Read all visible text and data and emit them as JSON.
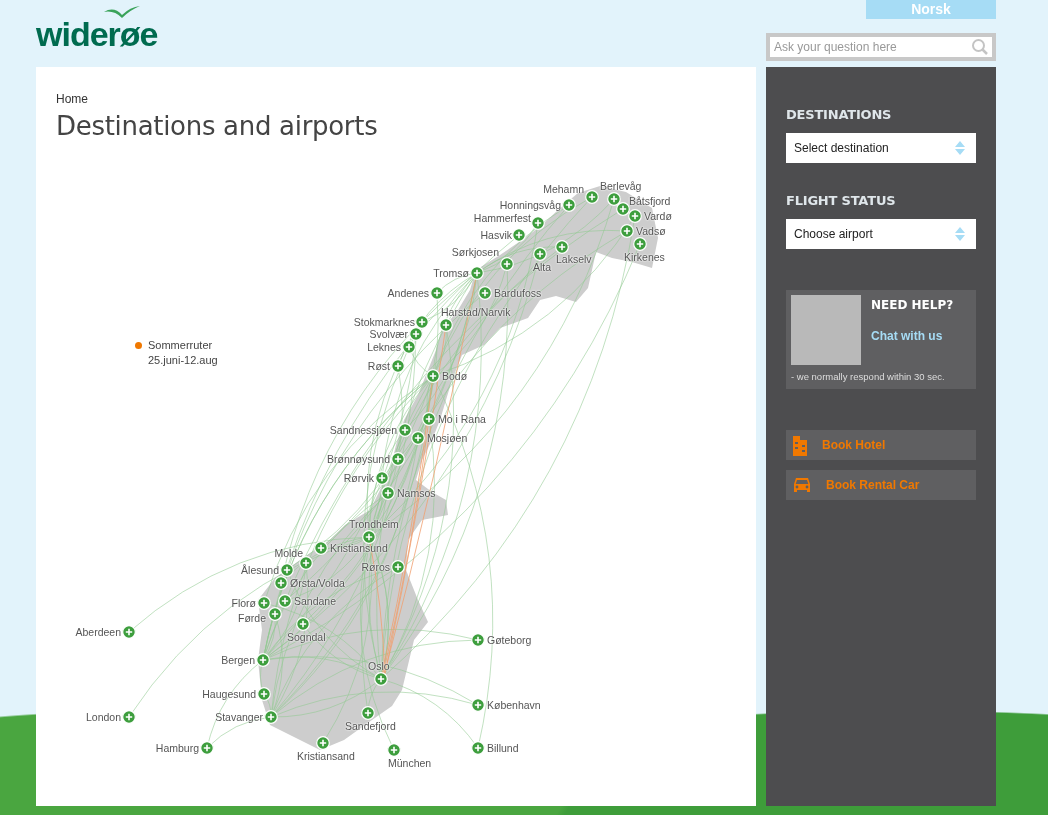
{
  "header": {
    "logo": "widerøe",
    "language_button": "Norsk",
    "search": {
      "placeholder": "Ask your question here"
    }
  },
  "breadcrumb": "Home",
  "title": "Destinations and airports",
  "map": {
    "legend": [
      {
        "label": "Sommerruter",
        "dates": "25.juni-12.aug",
        "color": "#f07800"
      }
    ],
    "airports": [
      "Mehamn",
      "Berlevåg",
      "Båtsfjord",
      "Vardø",
      "Vadsø",
      "Kirkenes",
      "Honningsvåg",
      "Hammerfest",
      "Hasvik",
      "Sørkjosen",
      "Lakselv",
      "Alta",
      "Tromsø",
      "Andenes",
      "Bardufoss",
      "Harstad/Narvik",
      "Stokmarknes",
      "Svolvær",
      "Leknes",
      "Røst",
      "Bodø",
      "Mo i Rana",
      "Sandnessjøen",
      "Mosjøen",
      "Brønnøysund",
      "Rørvik",
      "Namsos",
      "Trondheim",
      "Kristiansund",
      "Molde",
      "Ålesund",
      "Ørsta/Volda",
      "Røros",
      "Florø",
      "Sandane",
      "Førde",
      "Sogndal",
      "Aberdeen",
      "Gøteborg",
      "Bergen",
      "Oslo",
      "Haugesund",
      "Stavanger",
      "London",
      "København",
      "Sandefjord",
      "Kristiansand",
      "Hamburg",
      "Billund",
      "München"
    ]
  },
  "sidebar": {
    "sections": [
      {
        "heading": "DESTINATIONS",
        "value": "Select destination"
      },
      {
        "heading": "FLIGHT STATUS",
        "value": "Choose airport"
      }
    ],
    "help": {
      "heading": "NEED HELP?",
      "link": "Chat with us",
      "note": "- we normally respond within 30 sec."
    },
    "actions": [
      {
        "kind": "hotel",
        "label": "Book Hotel"
      },
      {
        "kind": "car",
        "label": "Book Rental Car"
      }
    ]
  }
}
